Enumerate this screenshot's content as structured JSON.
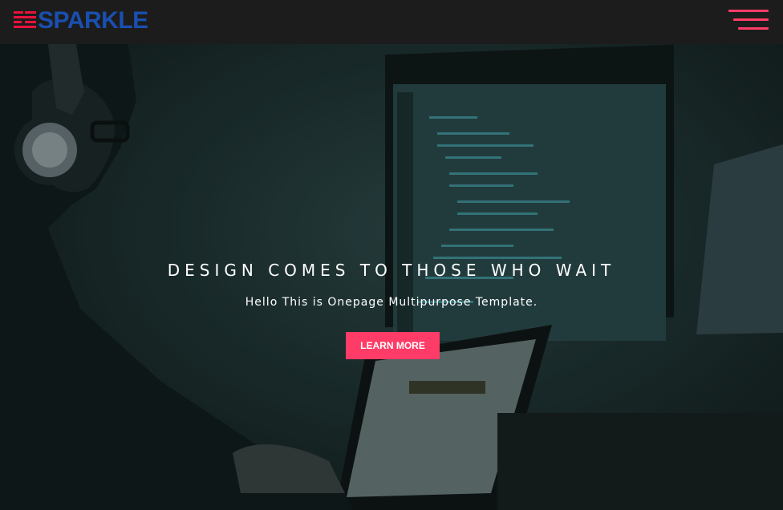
{
  "brand": {
    "name": "SPARKLE",
    "text_color": "#1a4fb0",
    "mark_color": "#e8133e",
    "mark_icon": "stacked-bars-logo-icon"
  },
  "nav": {
    "menu_icon": "hamburger-menu-icon",
    "accent_color": "#ff3c67",
    "background_color": "#1c1c1c"
  },
  "hero": {
    "title": "DESIGN COMES TO THOSE WHO WAIT",
    "subtitle": "Hello This is Onepage Multipurpose Template.",
    "cta_label": "LEARN MORE",
    "cta_color": "#ff3c67"
  }
}
